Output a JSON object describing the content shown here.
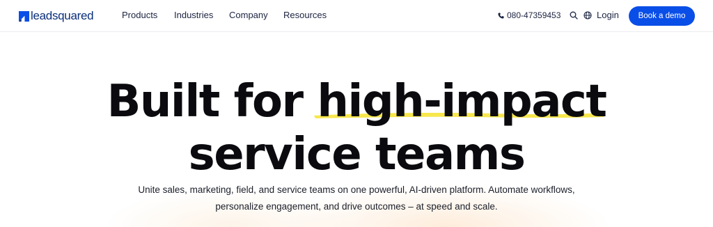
{
  "header": {
    "logo_text": "leadsquared",
    "nav": [
      "Products",
      "Industries",
      "Company",
      "Resources"
    ],
    "phone": "080-47359453",
    "login_label": "Login",
    "cta_label": "Book a demo"
  },
  "hero": {
    "title_part1": "Built for ",
    "title_highlight": "high-impact",
    "title_line2": "service teams",
    "subtitle_line1": "Unite sales, marketing, field, and service teams on one powerful, AI-driven platform. Automate workflows,",
    "subtitle_line2": "personalize engagement, and drive outcomes – at speed and scale."
  },
  "icons": {
    "phone": "phone-icon",
    "search": "search-icon",
    "globe": "globe-icon",
    "logo": "leadsquared-logo-mark"
  },
  "colors": {
    "brand_blue": "#0a4ee8",
    "logo_blue": "#0b2f7a",
    "highlight_yellow": "#f6e43a"
  }
}
